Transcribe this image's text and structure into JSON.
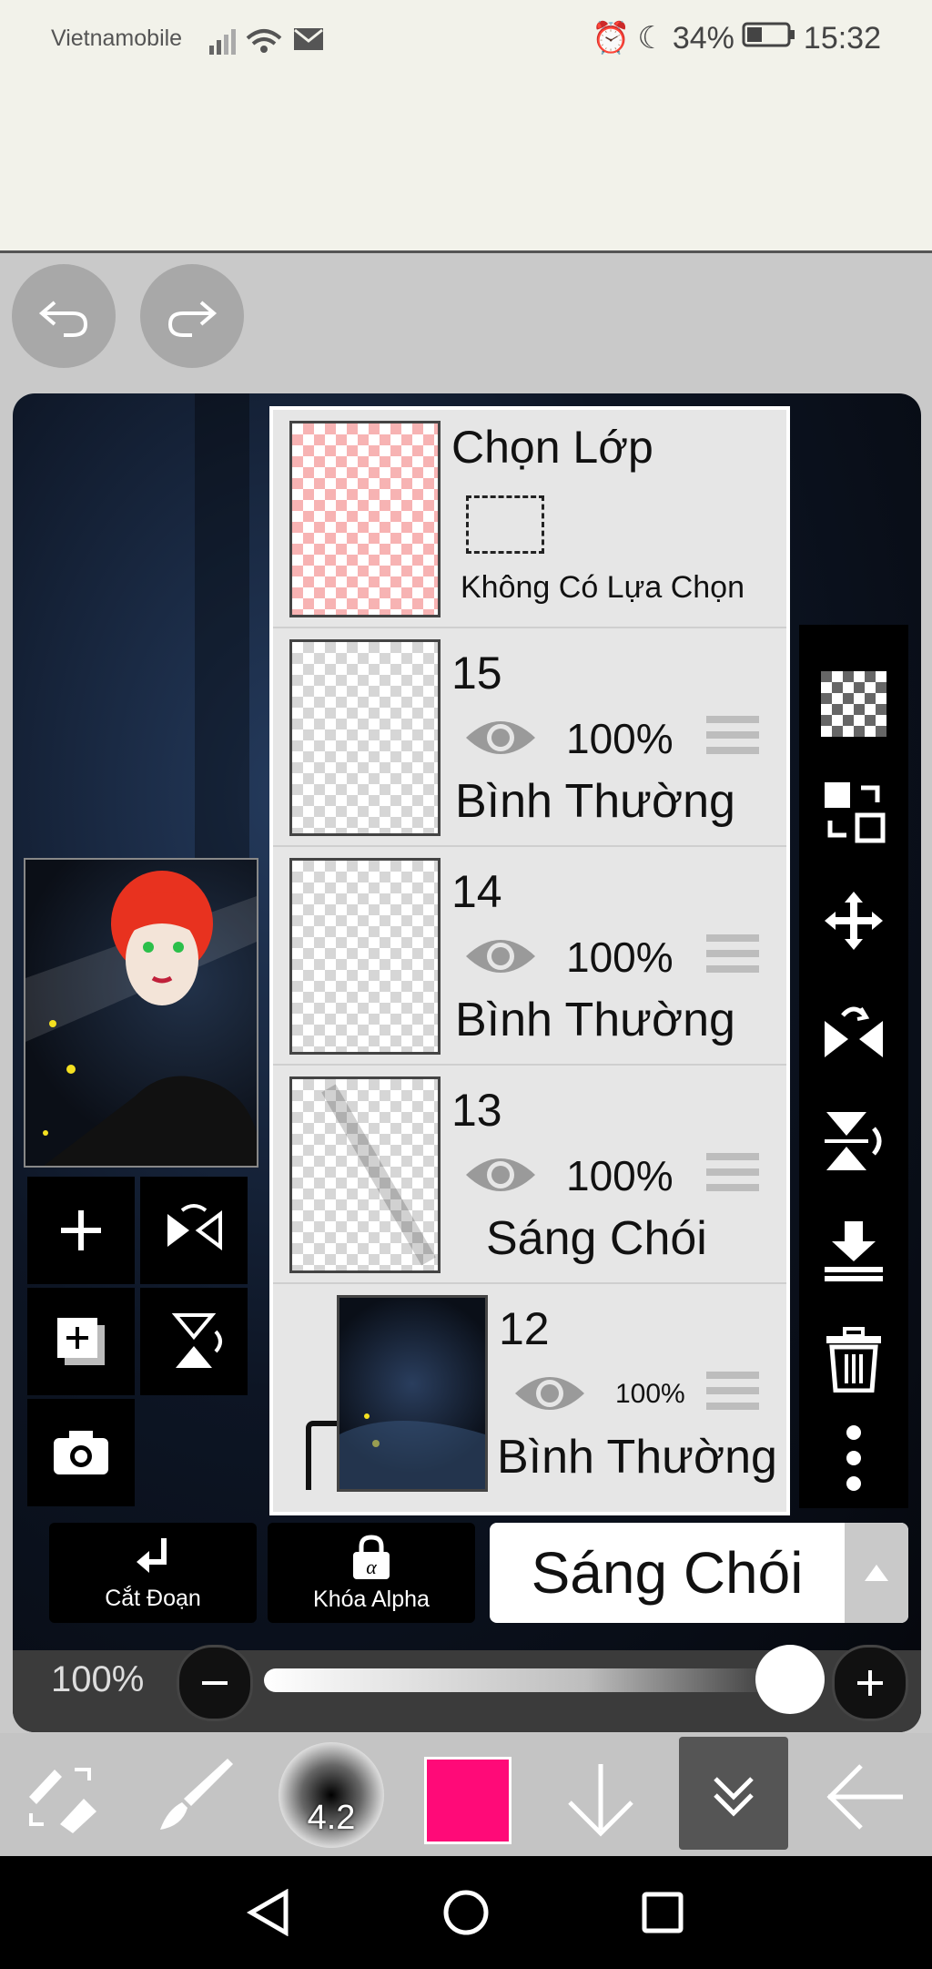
{
  "status_bar": {
    "carrier": "Vietnamobile",
    "battery_percent": "34%",
    "time": "15:32"
  },
  "layers_panel": {
    "selection_layer": {
      "title": "Chọn Lớp",
      "subtitle": "Không Có Lựa Chọn"
    },
    "layers": [
      {
        "name": "15",
        "opacity": "100%",
        "blend_mode": "Bình Thường",
        "visible": true
      },
      {
        "name": "14",
        "opacity": "100%",
        "blend_mode": "Bình Thường",
        "visible": true
      },
      {
        "name": "13",
        "opacity": "100%",
        "blend_mode": "Sáng Chói",
        "visible": true
      },
      {
        "name": "12",
        "opacity": "100%",
        "blend_mode": "Bình Thường",
        "visible": true
      }
    ]
  },
  "bottom_controls": {
    "clip_label": "Cắt Đoạn",
    "alpha_lock_label": "Khóa Alpha",
    "blend_mode_value": "Sáng Chói",
    "opacity_label": "100%",
    "opacity_value": 1.0
  },
  "toolbar": {
    "brush_size": "4.2",
    "color": "#ff0a78"
  },
  "icons": [
    "undo-icon",
    "redo-icon",
    "add-layer-icon",
    "flip-horizontal-icon",
    "copy-layer-icon",
    "flip-vertical-icon",
    "camera-icon",
    "checker-icon",
    "transform-icon",
    "move-icon",
    "mirror-icon",
    "merge-down-icon",
    "trash-icon",
    "more-icon",
    "back-icon",
    "home-icon",
    "recents-icon"
  ]
}
